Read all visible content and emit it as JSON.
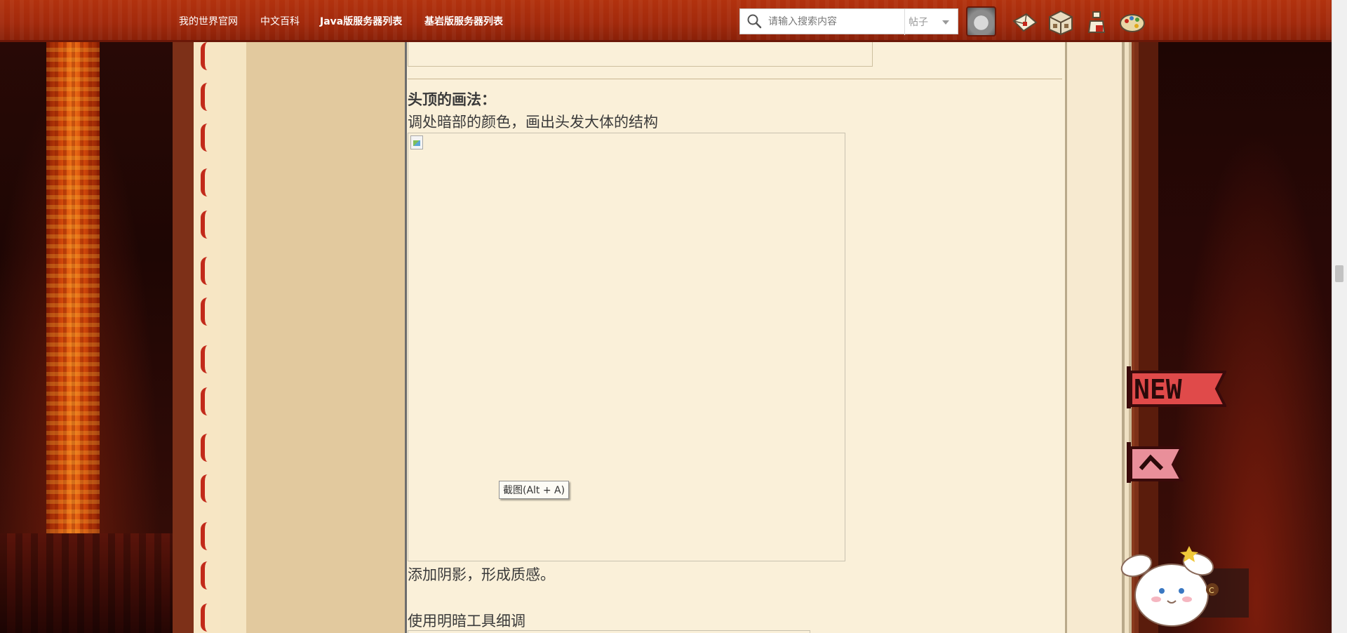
{
  "header": {
    "nav": [
      {
        "label": "我的世界官网"
      },
      {
        "label": "中文百科"
      },
      {
        "label": "Java版服务器列表"
      },
      {
        "label": "基岩版服务器列表"
      }
    ],
    "search": {
      "placeholder": "请输入搜索内容",
      "type_label": "帖子"
    },
    "icons": [
      "avatar",
      "mail-icon",
      "crafting-table-icon",
      "potion-icon",
      "palette-icon"
    ]
  },
  "content": {
    "heading": "头顶的画法：",
    "paragraphs": [
      "调处暗部的颜色，画出头发大体的结构",
      "添加阴影，形成质感。",
      "使用明暗工具细调"
    ],
    "tooltip": "截图(Alt + A)"
  },
  "side_widgets": {
    "new_label": "NEW"
  },
  "colors": {
    "header_red": "#a32a0c",
    "content_bg": "#faf0d9",
    "sidebar_tan": "#e2c99e",
    "frame_brown": "#7d3018",
    "text": "#3a3a3a"
  }
}
